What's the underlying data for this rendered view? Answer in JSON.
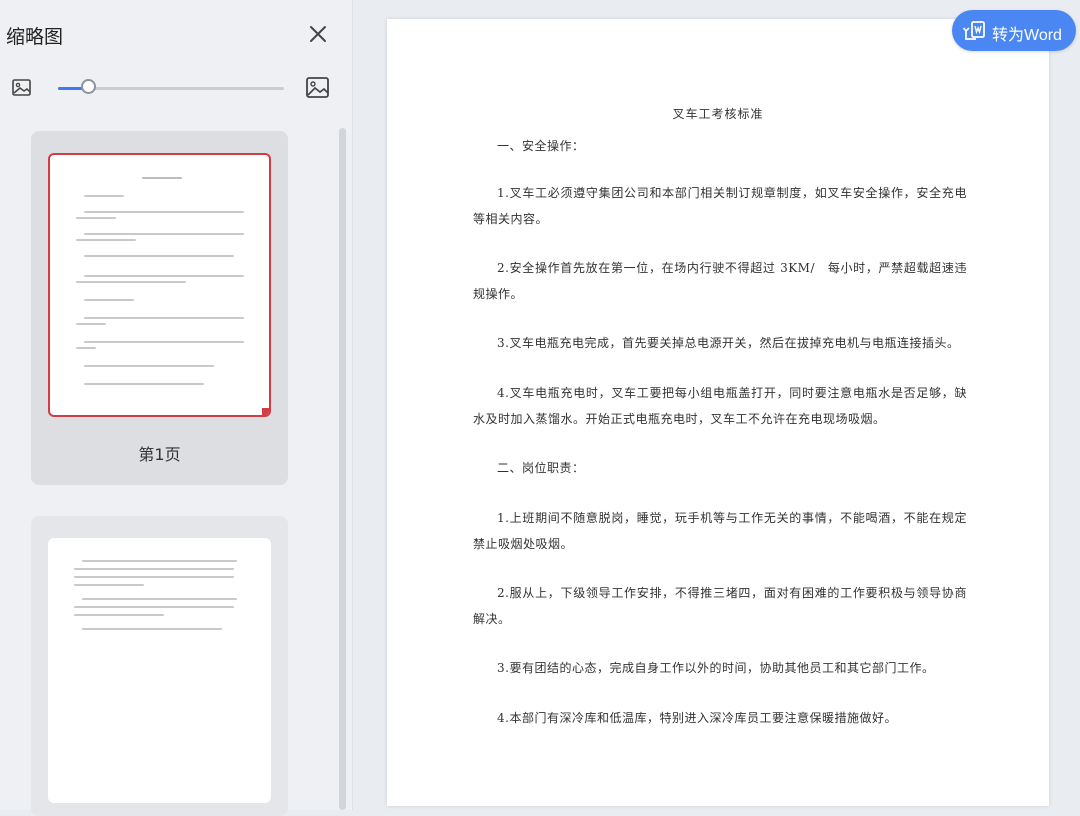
{
  "sidebar": {
    "title": "缩略图",
    "close_icon": "close-icon",
    "zoom": {
      "small_icon": "image-small-icon",
      "large_icon": "image-large-icon",
      "level": 0.14
    },
    "thumbnails": [
      {
        "label": "第1页",
        "selected": true
      },
      {
        "label": "",
        "selected": false
      }
    ],
    "accent_color": "#3d7cf0",
    "selected_color": "#d23c45"
  },
  "toolbar": {
    "convert_label": "转为Word",
    "convert_icon": "convert-to-word-icon",
    "button_color": "#4a87f2"
  },
  "document": {
    "title": "叉车工考核标准",
    "paragraphs": [
      "一、安全操作：",
      "1.叉车工必须遵守集团公司和本部门相关制订规章制度，如叉车安全操作，安全充电等相关内容。",
      "2.安全操作首先放在第一位，在场内行驶不得超过 3KM/　每小时，严禁超载超速违规操作。",
      "3.叉车电瓶充电完成，首先要关掉总电源开关，然后在拔掉充电机与电瓶连接插头。",
      "4.叉车电瓶充电时，叉车工要把每小组电瓶盖打开，同时要注意电瓶水是否足够，缺水及时加入蒸馏水。开始正式电瓶充电时，叉车工不允许在充电现场吸烟。",
      "二、岗位职责：",
      "1.上班期间不随意脱岗，睡觉，玩手机等与工作无关的事情，不能喝酒，不能在规定禁止吸烟处吸烟。",
      "2.服从上，下级领导工作安排，不得推三堵四，面对有困难的工作要积极与领导协商解决。",
      "3.要有团结的心态，完成自身工作以外的时间，协助其他员工和其它部门工作。",
      "4.本部门有深冷库和低温库，特别进入深冷库员工要注意保暖措施做好。"
    ]
  }
}
